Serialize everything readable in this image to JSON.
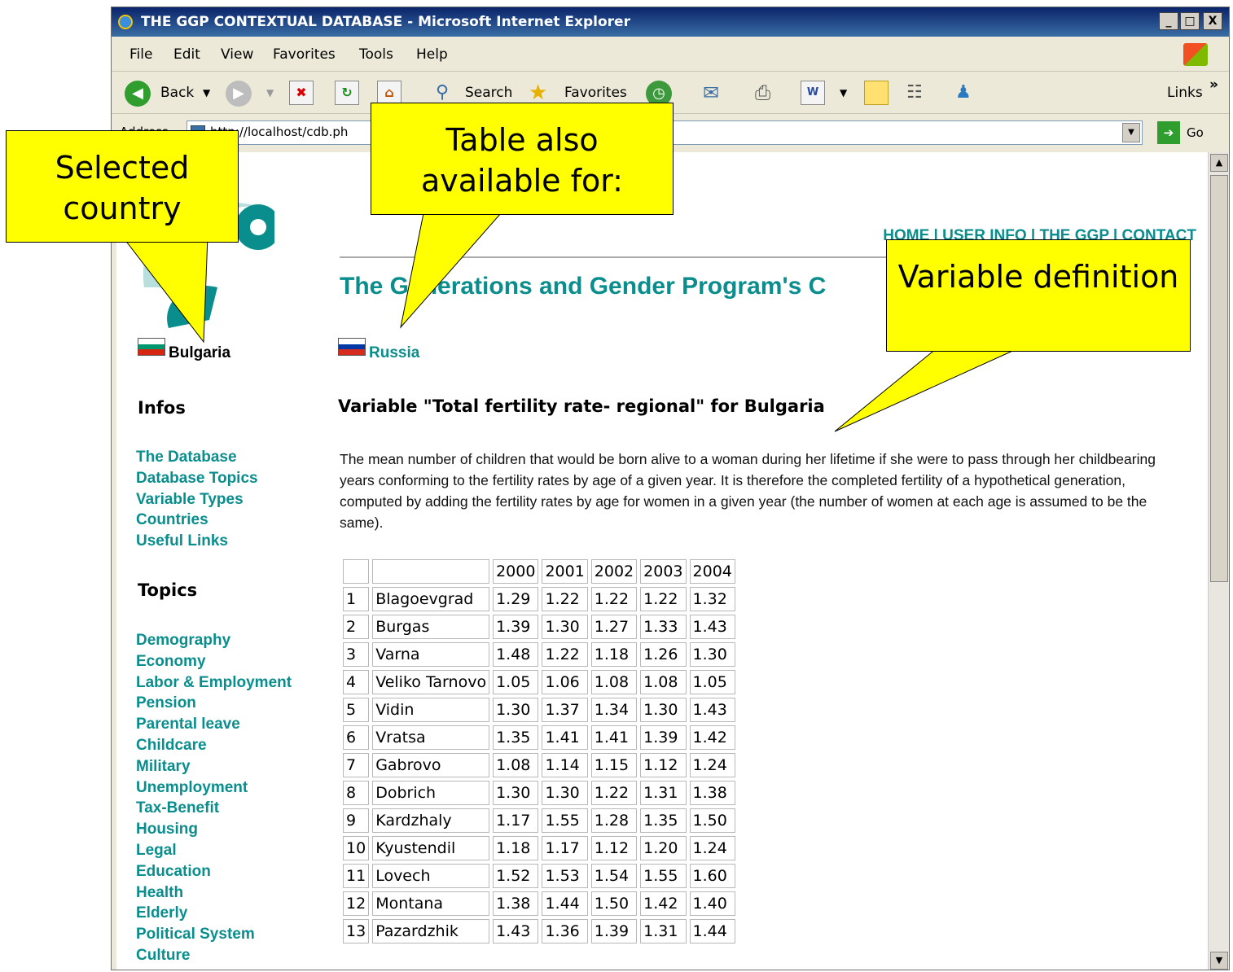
{
  "window": {
    "title": "THE GGP CONTEXTUAL DATABASE - Microsoft Internet Explorer",
    "buttons": {
      "minimize": "_",
      "maximize": "□",
      "close": "X"
    }
  },
  "menu": [
    "File",
    "Edit",
    "View",
    "Favorites",
    "Tools",
    "Help"
  ],
  "toolbar": {
    "back": "Back",
    "search": "Search",
    "favorites": "Favorites",
    "links": "Links",
    "chevron": "»"
  },
  "address": {
    "label": "Address",
    "url": "http://localhost/cdb.ph",
    "go": "Go"
  },
  "page": {
    "top_nav": "HOME | USER INFO | THE GGP | CONTACT",
    "title": "The Generations and Gender Program's C",
    "selected_country": "Bulgaria",
    "other_country": "Russia",
    "infos_heading": "Infos",
    "infos_links": [
      "The Database",
      "Database Topics",
      "Variable Types",
      "Countries",
      "Useful Links"
    ],
    "topics_heading": "Topics",
    "topics_links": [
      "Demography",
      "Economy",
      "Labor & Employment",
      "Pension",
      "Parental leave",
      "Childcare",
      "Military",
      "Unemployment",
      "Tax-Benefit",
      "Housing",
      "Legal",
      "Education",
      "Health",
      "Elderly",
      "Political System",
      "Culture"
    ],
    "variable_heading": "Variable \"Total fertility rate- regional\" for Bulgaria",
    "variable_definition": "The mean number of children that would be born alive to a woman during her lifetime if she were to pass through her childbearing years conforming to the fertility rates by age of a given year. It is therefore the completed fertility of a hypothetical generation, computed by adding the fertility rates by age for women in a given year (the number of women at each age is assumed to be the same).",
    "table": {
      "years": [
        "2000",
        "2001",
        "2002",
        "2003",
        "2004"
      ],
      "rows": [
        {
          "n": "1",
          "region": "Blagoevgrad",
          "v": [
            "1.29",
            "1.22",
            "1.22",
            "1.22",
            "1.32"
          ]
        },
        {
          "n": "2",
          "region": "Burgas",
          "v": [
            "1.39",
            "1.30",
            "1.27",
            "1.33",
            "1.43"
          ]
        },
        {
          "n": "3",
          "region": "Varna",
          "v": [
            "1.48",
            "1.22",
            "1.18",
            "1.26",
            "1.30"
          ]
        },
        {
          "n": "4",
          "region": "Veliko Tarnovo",
          "v": [
            "1.05",
            "1.06",
            "1.08",
            "1.08",
            "1.05"
          ]
        },
        {
          "n": "5",
          "region": "Vidin",
          "v": [
            "1.30",
            "1.37",
            "1.34",
            "1.30",
            "1.43"
          ]
        },
        {
          "n": "6",
          "region": "Vratsa",
          "v": [
            "1.35",
            "1.41",
            "1.41",
            "1.39",
            "1.42"
          ]
        },
        {
          "n": "7",
          "region": "Gabrovo",
          "v": [
            "1.08",
            "1.14",
            "1.15",
            "1.12",
            "1.24"
          ]
        },
        {
          "n": "8",
          "region": "Dobrich",
          "v": [
            "1.30",
            "1.30",
            "1.22",
            "1.31",
            "1.38"
          ]
        },
        {
          "n": "9",
          "region": "Kardzhaly",
          "v": [
            "1.17",
            "1.55",
            "1.28",
            "1.35",
            "1.50"
          ]
        },
        {
          "n": "10",
          "region": "Kyustendil",
          "v": [
            "1.18",
            "1.17",
            "1.12",
            "1.20",
            "1.24"
          ]
        },
        {
          "n": "11",
          "region": "Lovech",
          "v": [
            "1.52",
            "1.53",
            "1.54",
            "1.55",
            "1.60"
          ]
        },
        {
          "n": "12",
          "region": "Montana",
          "v": [
            "1.38",
            "1.44",
            "1.50",
            "1.42",
            "1.40"
          ]
        },
        {
          "n": "13",
          "region": "Pazardzhik",
          "v": [
            "1.43",
            "1.36",
            "1.39",
            "1.31",
            "1.44"
          ]
        }
      ]
    }
  },
  "callouts": {
    "selected_country": "Selected country",
    "table_available": "Table also available for:",
    "variable_definition": "Variable definition"
  },
  "colors": {
    "link": "#0a8d8d",
    "callout": "#ffff00",
    "titlebar": "#0a246a"
  },
  "icons": {
    "logo": "ggp-logo",
    "flag_bg": "bulgaria-flag-icon",
    "flag_ru": "russia-flag-icon"
  }
}
